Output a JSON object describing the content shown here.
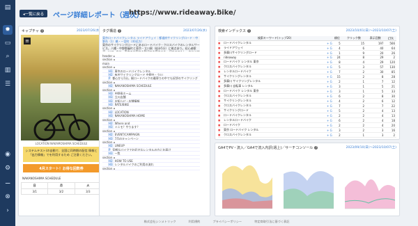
{
  "header": {
    "back_label": "◂一覧に戻る",
    "title": "ページ詳細レポート（週次）",
    "url": "https://www.rideaway.bike/"
  },
  "capture": {
    "title": "キャプチャ",
    "date": "2023/07/26(水)",
    "caption": "LOCATION\nNAKAMOSHIMA SCHEDULE",
    "note": "システムテスト(の自動で、全国に同時期の配信\n情報と「出力情報」でを利用するため\nご注意ください。",
    "cta": "4月スタート！お得な回数券",
    "schedule_title": "NAKANOSHIMA SCHEDULE",
    "schedule_cols": [
      "日",
      "月",
      "火"
    ],
    "schedule_row": [
      "3/1",
      "3/2",
      "3/3"
    ]
  },
  "tags": {
    "title": "タグ構造",
    "date": "2023/07/26(水)",
    "head_link": "東京ロードバイクレンタル ライドアウェイ｜都道府サイクリングロード・中野台（1）橋・一宮町（40近方）",
    "head_text": "東京のサイクリングロードにあるロードバイク・クロスバイクのレンタルサービス。八幡・中野都審町と東京・立川駅（徒歩5分）に拠点あり。初心者歓迎・ツアー有り。東京のお客さま歓迎のお客さまを、初めてでもしっかりとサポート。スポーツバイクを楽しめる環境を整えています。",
    "items": [
      {
        "t": "header ◂",
        "l": ""
      },
      {
        "t": "section ◂",
        "l": ""
      },
      {
        "t": "main",
        "l": ""
      },
      {
        "t": "section ◂",
        "l": ""
      },
      {
        "t": "東京のロードバイクレンタル",
        "l": "H1"
      },
      {
        "t": "有名サイクリングロード 中野台・立川",
        "l": "H2"
      },
      {
        "t": "都心から5分。駅ロードバイクの最寄りの中でも好評のサイクリング",
        "l": "P"
      },
      {
        "t": "section ◂",
        "l": ""
      },
      {
        "t": "NAKANOSHIMA SCHEDULE",
        "l": "H2"
      },
      {
        "t": "section ◂",
        "l": ""
      },
      {
        "t": "中野島ホーム",
        "l": "H3"
      },
      {
        "t": "立川店舗",
        "l": "H3"
      },
      {
        "t": "お知らせ・店舗情報",
        "l": "H3"
      },
      {
        "t": "RATE/BIKE",
        "l": "H3"
      },
      {
        "t": "section ◂",
        "l": ""
      },
      {
        "t": "LOCATION",
        "l": "H2"
      },
      {
        "t": "NAKANOSHIMA HOME",
        "l": "H3"
      },
      {
        "t": "section ◂",
        "l": ""
      },
      {
        "t": "Where and",
        "l": "H2"
      },
      {
        "t": "ミニモ？やります？",
        "l": "H3"
      },
      {
        "t": "section ◂",
        "l": ""
      },
      {
        "t": "EVENT/CAMPAIGN",
        "l": "H2"
      },
      {
        "t": "7月のキャンペーン",
        "l": "H3"
      },
      {
        "t": "section ◂",
        "l": ""
      },
      {
        "t": "LINEUP",
        "l": "H2"
      },
      {
        "t": "気軽なバイクでお好きなレンタルの方にお届け",
        "l": "P"
      },
      {
        "t": "一覧",
        "l": "H3"
      },
      {
        "t": "section ◂",
        "l": ""
      },
      {
        "t": "HOW TO USE",
        "l": "H2"
      },
      {
        "t": "レンタルバイクのご利用の流れ",
        "l": "H3"
      },
      {
        "t": "section ◂",
        "l": ""
      }
    ]
  },
  "keywords": {
    "title": "検索インデックス",
    "range": "2023/10/01(日)～2023/10/07(土)",
    "cols": [
      "検索キーワード(トップ20)",
      "順位",
      "クリック数",
      "表示回数",
      "CTR"
    ],
    "rows": [
      [
        "ロードバイクレンタル",
        "5",
        "15",
        "197",
        "566"
      ],
      [
        "ライドアウェイ",
        "4",
        "6",
        "40",
        "64"
      ],
      [
        "多摩川サイクリングロード",
        "1",
        "9",
        "20",
        "26"
      ],
      [
        "rideaway",
        "24",
        "8",
        "29",
        "2"
      ],
      [
        "ロードバイク レンタル 東京",
        "8",
        "4",
        "29",
        "120"
      ],
      [
        "クロスバイクレンタル",
        "5",
        "3",
        "57",
        "130"
      ],
      [
        "レンタルロードバイク",
        "7",
        "2",
        "30",
        "85"
      ],
      [
        "サイクリングレンタル",
        "15",
        "2",
        "8",
        "28"
      ],
      [
        "多摩川 サイクリングレンタル",
        "2",
        "1",
        "7",
        "12"
      ],
      [
        "多摩川 自転車 レンタル",
        "3",
        "1",
        "5",
        "21"
      ],
      [
        "ロードバイク レンタル 東京",
        "3",
        "1",
        "5",
        "33"
      ],
      [
        "クロスバイクレンタル",
        "6",
        "2",
        "8",
        "30"
      ],
      [
        "サイクリングレンタル",
        "4",
        "2",
        "6",
        "12"
      ],
      [
        "クロスバイクレンタル",
        "7",
        "2",
        "7",
        "22"
      ],
      [
        "サイクリングロード",
        "5",
        "2",
        "4",
        "13"
      ],
      [
        "ロードバイクレンタル",
        "2",
        "2",
        "4",
        "13"
      ],
      [
        "レンタルロードバイク",
        "6",
        "2",
        "4",
        "18"
      ],
      [
        "ロードバイク",
        "2",
        "2",
        "4",
        "20"
      ],
      [
        "東京 ロードバイク レンタル",
        "3",
        "2",
        "3",
        "16"
      ],
      [
        "クロスバイクレンタル",
        "2",
        "1",
        "3",
        "2"
      ]
    ]
  },
  "ga": {
    "title": "GA4でPV・流入／GA4で流入内訳(週上)／サーチコンソール",
    "range": "2023/09/10(日)～2023/10/07(土)"
  },
  "footer": {
    "items": [
      "株式会社シンメトリック",
      "利用規約",
      "プライバシーポリシー",
      "特定商取引法に基づく表記"
    ]
  },
  "colors": {
    "accent": "#3a7fd5",
    "nav": "#1e3a5f",
    "cta": "#f39a2b"
  }
}
